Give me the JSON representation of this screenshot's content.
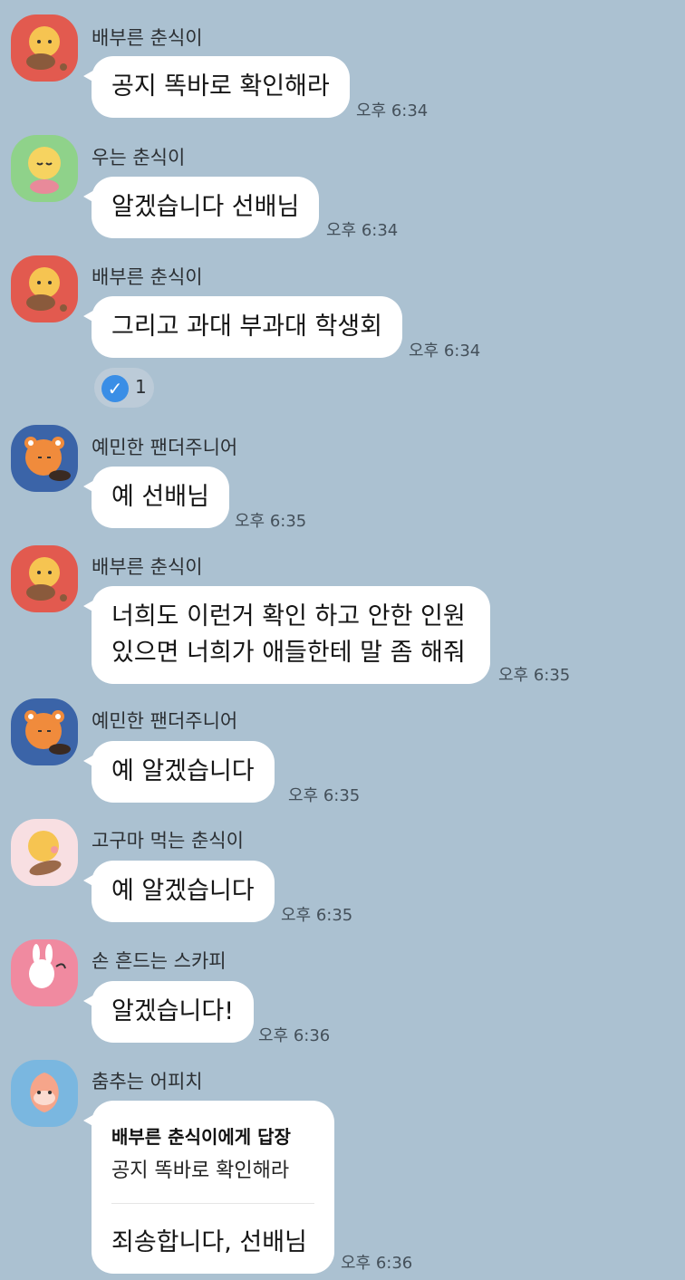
{
  "messages": [
    {
      "name": "배부른 춘식이",
      "lines": [
        "공지 똑바로 확인해라"
      ],
      "time": "오후 6:34",
      "avatar": "full-choonsik-avatar"
    },
    {
      "name": "우는 춘식이",
      "lines": [
        "알겠습니다 선배님"
      ],
      "time": "오후 6:34",
      "avatar": "crying-choonsik-avatar"
    },
    {
      "name": "배부른 춘식이",
      "lines": [
        "그리고 과대 부과대 학생회"
      ],
      "time": "오후 6:34",
      "avatar": "full-choonsik-avatar",
      "reaction_count": "1"
    },
    {
      "name": "예민한 팬더주니어",
      "lines": [
        "예 선배님"
      ],
      "time": "오후 6:35",
      "avatar": "panda-junior-avatar"
    },
    {
      "name": "배부른 춘식이",
      "lines": [
        "너희도 이런거 확인 하고 안한 인원",
        "있으면 너희가 애들한테 말 좀 해줘"
      ],
      "time": "오후 6:35",
      "avatar": "full-choonsik-avatar"
    },
    {
      "name": "예민한 팬더주니어",
      "lines": [
        "예 알겠습니다"
      ],
      "time": "오후 6:35",
      "avatar": "panda-junior-avatar"
    },
    {
      "name": "고구마 먹는 춘식이",
      "lines": [
        "예 알겠습니다"
      ],
      "time": "오후 6:35",
      "avatar": "sweetpotato-choonsik-avatar"
    },
    {
      "name": "손 흔드는 스카피",
      "lines": [
        "알겠습니다!"
      ],
      "time": "오후 6:36",
      "avatar": "scarpy-avatar"
    },
    {
      "name": "춤추는 어피치",
      "reply_to": "배부른 춘식이에게 답장",
      "quote": "공지 똑바로 확인해라",
      "lines": [
        "죄송합니다, 선배님"
      ],
      "time": "오후 6:36",
      "avatar": "apeach-avatar"
    }
  ],
  "colors": {
    "background": "#abc1d1",
    "bubble": "#ffffff",
    "reaction_check": "#3a8ee6"
  }
}
